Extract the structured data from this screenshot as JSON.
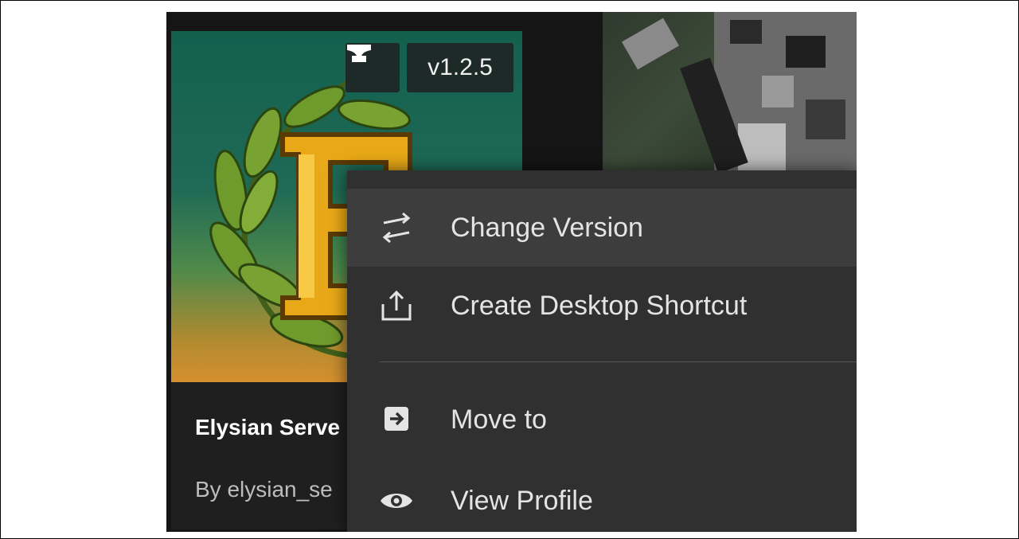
{
  "card": {
    "title": "Elysian Serve",
    "author": "By elysian_se",
    "version": "v1.2.5",
    "loader_icon": "anvil-icon",
    "logo_icon": "laurel-letter-e-logo"
  },
  "second_card": {
    "image_icon": "blocky-character-image"
  },
  "context_menu": {
    "items": [
      {
        "label": "Change Version",
        "icon": "swap-arrows-icon"
      },
      {
        "label": "Create Desktop Shortcut",
        "icon": "share-upload-icon"
      },
      {
        "label": "Move to",
        "icon": "move-to-folder-icon"
      },
      {
        "label": "View Profile",
        "icon": "eye-icon"
      }
    ]
  },
  "colors": {
    "menu_bg": "#303030",
    "menu_hover": "#3d3d3d",
    "card_bg": "#1f1f1f",
    "badge_bg": "#1e2a27",
    "text": "#e4e4e4"
  }
}
